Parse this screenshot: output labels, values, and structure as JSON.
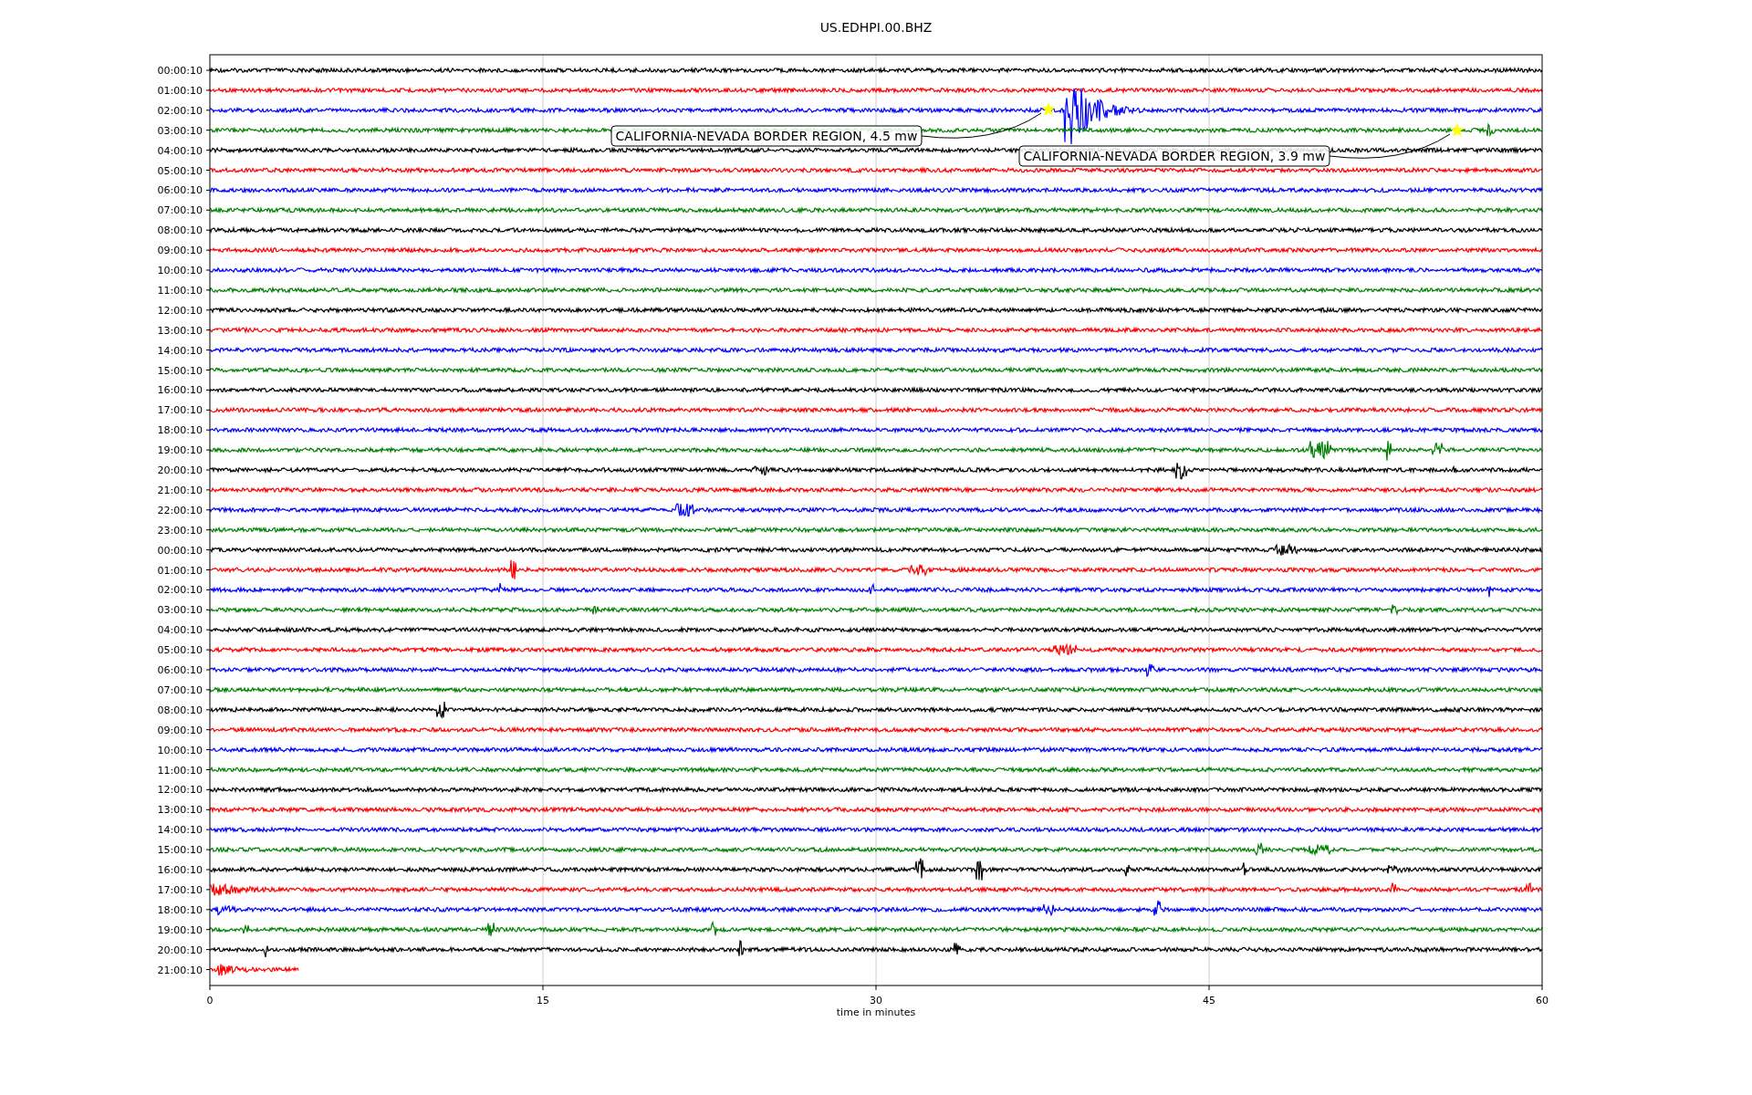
{
  "title": "US.EDHPI.00.BHZ",
  "traces": [
    {
      "label": "00:00:10",
      "color": "#000000"
    },
    {
      "label": "01:00:10",
      "color": "#ff0000"
    },
    {
      "label": "02:00:10",
      "color": "#0000ff"
    },
    {
      "label": "03:00:10",
      "color": "#008000"
    },
    {
      "label": "04:00:10",
      "color": "#000000"
    },
    {
      "label": "05:00:10",
      "color": "#ff0000"
    },
    {
      "label": "06:00:10",
      "color": "#0000ff"
    },
    {
      "label": "07:00:10",
      "color": "#008000"
    },
    {
      "label": "08:00:10",
      "color": "#000000"
    },
    {
      "label": "09:00:10",
      "color": "#ff0000"
    },
    {
      "label": "10:00:10",
      "color": "#0000ff"
    },
    {
      "label": "11:00:10",
      "color": "#008000"
    },
    {
      "label": "12:00:10",
      "color": "#000000"
    },
    {
      "label": "13:00:10",
      "color": "#ff0000"
    },
    {
      "label": "14:00:10",
      "color": "#0000ff"
    },
    {
      "label": "15:00:10",
      "color": "#008000"
    },
    {
      "label": "16:00:10",
      "color": "#000000"
    },
    {
      "label": "17:00:10",
      "color": "#ff0000"
    },
    {
      "label": "18:00:10",
      "color": "#0000ff"
    },
    {
      "label": "19:00:10",
      "color": "#008000"
    },
    {
      "label": "20:00:10",
      "color": "#000000"
    },
    {
      "label": "21:00:10",
      "color": "#ff0000"
    },
    {
      "label": "22:00:10",
      "color": "#0000ff"
    },
    {
      "label": "23:00:10",
      "color": "#008000"
    },
    {
      "label": "00:00:10",
      "color": "#000000"
    },
    {
      "label": "01:00:10",
      "color": "#ff0000"
    },
    {
      "label": "02:00:10",
      "color": "#0000ff"
    },
    {
      "label": "03:00:10",
      "color": "#008000"
    },
    {
      "label": "04:00:10",
      "color": "#000000"
    },
    {
      "label": "05:00:10",
      "color": "#ff0000"
    },
    {
      "label": "06:00:10",
      "color": "#0000ff"
    },
    {
      "label": "07:00:10",
      "color": "#008000"
    },
    {
      "label": "08:00:10",
      "color": "#000000"
    },
    {
      "label": "09:00:10",
      "color": "#ff0000"
    },
    {
      "label": "10:00:10",
      "color": "#0000ff"
    },
    {
      "label": "11:00:10",
      "color": "#008000"
    },
    {
      "label": "12:00:10",
      "color": "#000000"
    },
    {
      "label": "13:00:10",
      "color": "#ff0000"
    },
    {
      "label": "14:00:10",
      "color": "#0000ff"
    },
    {
      "label": "15:00:10",
      "color": "#008000"
    },
    {
      "label": "16:00:10",
      "color": "#000000"
    },
    {
      "label": "17:00:10",
      "color": "#ff0000"
    },
    {
      "label": "18:00:10",
      "color": "#0000ff"
    },
    {
      "label": "19:00:10",
      "color": "#008000"
    },
    {
      "label": "20:00:10",
      "color": "#000000"
    },
    {
      "label": "21:00:10",
      "color": "#ff0000"
    }
  ],
  "x_axis": {
    "ticks": [
      "0",
      "15",
      "30",
      "45",
      "60"
    ],
    "label": "time in minutes"
  },
  "events": [
    {
      "text": "CALIFORNIA-NEVADA BORDER REGION, 4.5 mw"
    },
    {
      "text": "CALIFORNIA-NEVADA BORDER REGION, 3.9 mw"
    }
  ]
}
